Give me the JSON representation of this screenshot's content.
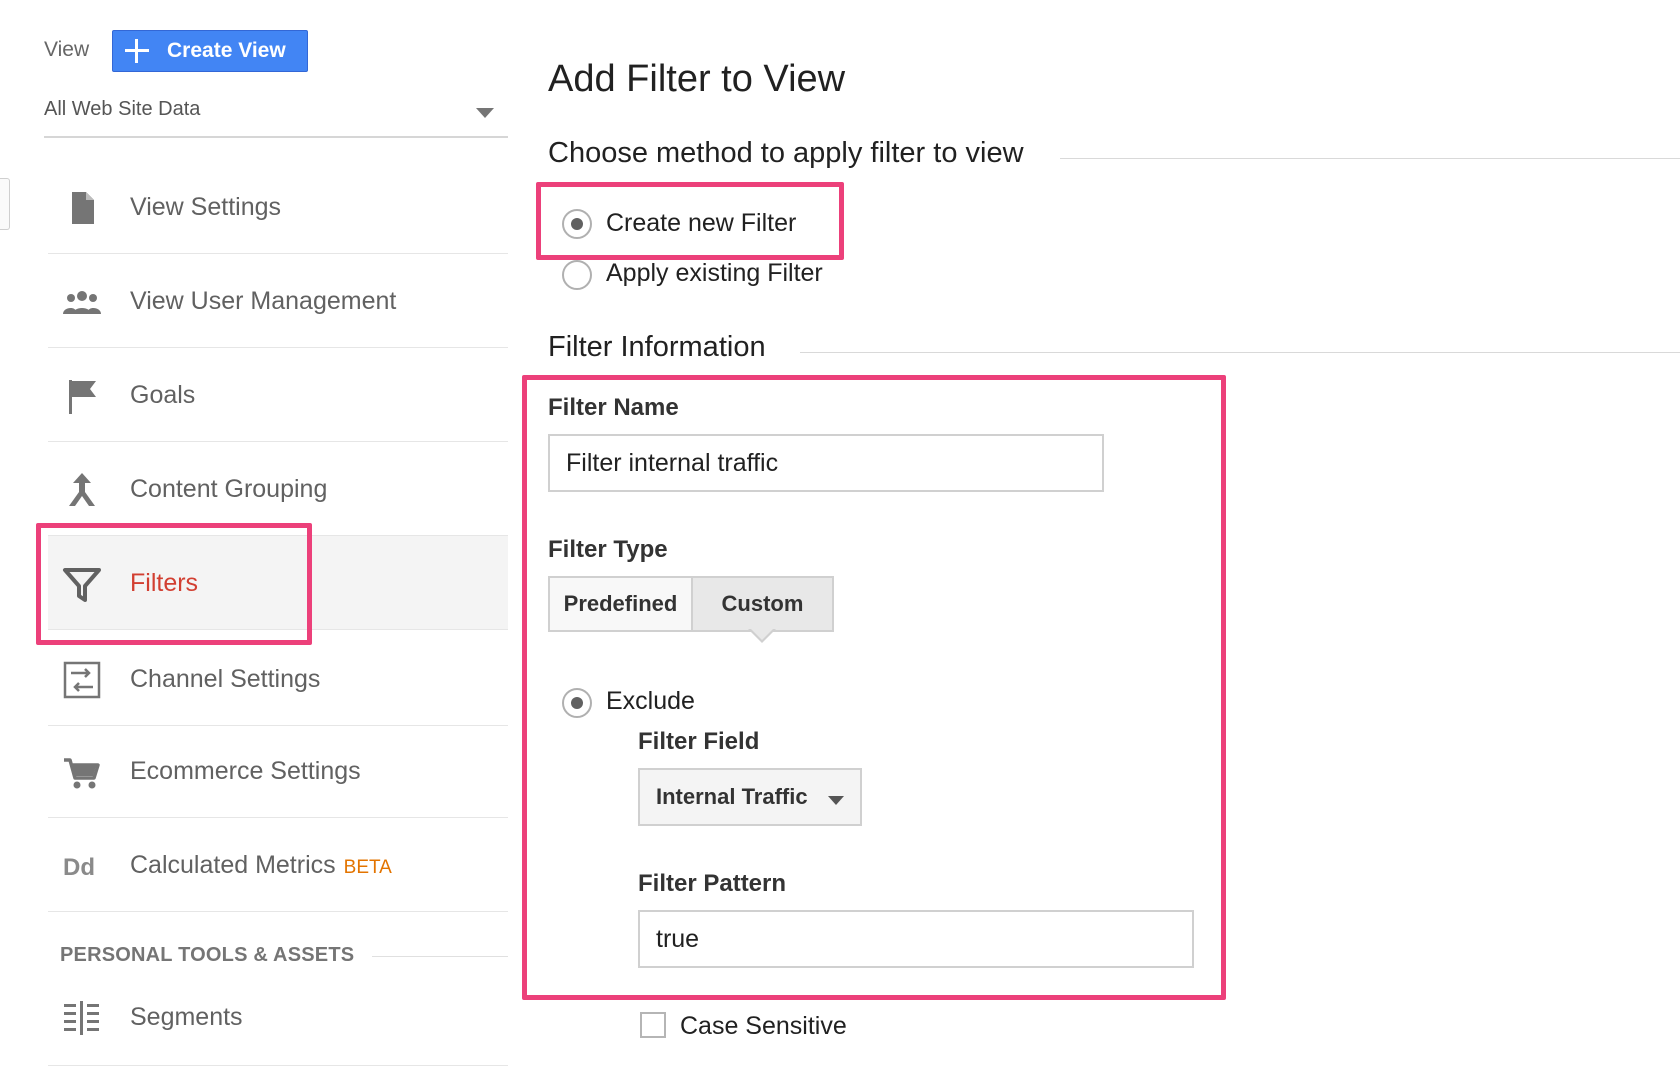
{
  "sidebar": {
    "view_label": "View",
    "create_view_label": "Create View",
    "view_selector": "All Web Site Data",
    "items": [
      {
        "label": "View Settings",
        "icon": "document-icon"
      },
      {
        "label": "View User Management",
        "icon": "users-icon"
      },
      {
        "label": "Goals",
        "icon": "flag-icon"
      },
      {
        "label": "Content Grouping",
        "icon": "merge-icon"
      },
      {
        "label": "Filters",
        "icon": "funnel-icon",
        "active": true
      },
      {
        "label": "Channel Settings",
        "icon": "channel-settings-icon"
      },
      {
        "label": "Ecommerce Settings",
        "icon": "cart-icon"
      },
      {
        "label": "Calculated Metrics",
        "badge": "BETA",
        "icon": "dd-icon"
      }
    ],
    "section_header": "PERSONAL TOOLS & ASSETS",
    "tools": [
      {
        "label": "Segments",
        "icon": "segments-icon"
      }
    ]
  },
  "main": {
    "title": "Add Filter to View",
    "method_heading": "Choose method to apply filter to view",
    "method_options": [
      {
        "label": "Create new Filter",
        "checked": true
      },
      {
        "label": "Apply existing Filter",
        "checked": false
      }
    ],
    "info_heading": "Filter Information",
    "filter_name_label": "Filter Name",
    "filter_name_value": "Filter internal traffic",
    "filter_type_label": "Filter Type",
    "filter_type_tabs": [
      {
        "label": "Predefined",
        "selected": false
      },
      {
        "label": "Custom",
        "selected": true
      }
    ],
    "exclude_label": "Exclude",
    "filter_field_label": "Filter Field",
    "filter_field_value": "Internal Traffic",
    "filter_pattern_label": "Filter Pattern",
    "filter_pattern_value": "true",
    "case_sensitive_label": "Case Sensitive"
  },
  "colors": {
    "primary_button": "#4285f4",
    "active_nav_text": "#d23f31",
    "beta_badge": "#e37400",
    "highlight_border": "#ec407a"
  }
}
